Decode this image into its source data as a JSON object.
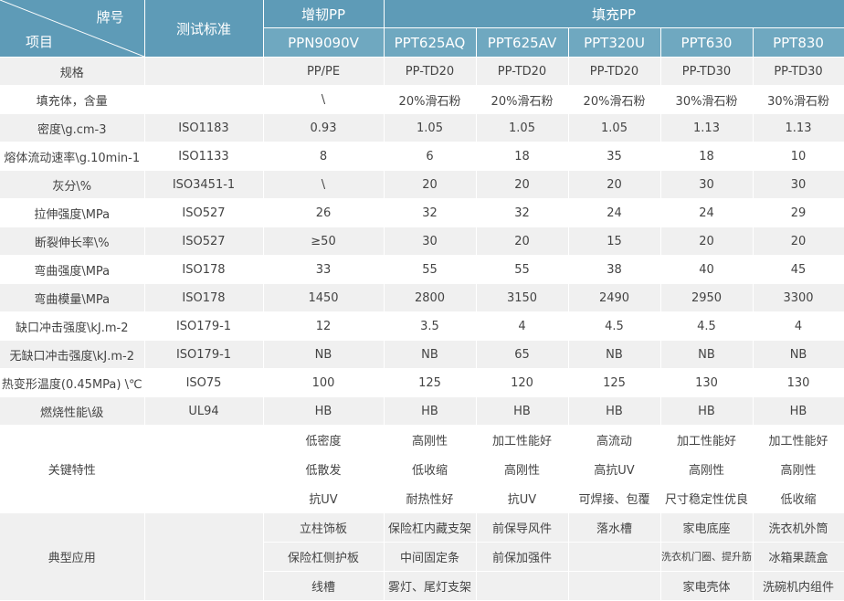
{
  "header": {
    "brand_label": "牌号",
    "item_label": "项目",
    "standard_label": "测试标准",
    "group_toughened": "增韧PP",
    "group_filled": "填充PP",
    "grades": [
      "PPN9090V",
      "PPT625AQ",
      "PPT625AV",
      "PPT320U",
      "PPT630",
      "PPT830"
    ]
  },
  "rows": [
    {
      "label": "规格",
      "standard": "",
      "values": [
        "PP/PE",
        "PP-TD20",
        "PP-TD20",
        "PP-TD20",
        "PP-TD30",
        "PP-TD30"
      ]
    },
    {
      "label": "填充体，含量",
      "standard": "",
      "values": [
        "\\",
        "20%滑石粉",
        "20%滑石粉",
        "20%滑石粉",
        "30%滑石粉",
        "30%滑石粉"
      ]
    },
    {
      "label": "密度\\g.cm-3",
      "standard": "ISO1183",
      "values": [
        "0.93",
        "1.05",
        "1.05",
        "1.05",
        "1.13",
        "1.13"
      ]
    },
    {
      "label": "熔体流动速率\\g.10min-1",
      "standard": "ISO1133",
      "values": [
        "8",
        "6",
        "18",
        "35",
        "18",
        "10"
      ]
    },
    {
      "label": "灰分\\%",
      "standard": "ISO3451-1",
      "values": [
        "\\",
        "20",
        "20",
        "20",
        "30",
        "30"
      ]
    },
    {
      "label": "拉伸强度\\MPa",
      "standard": "ISO527",
      "values": [
        "26",
        "32",
        "32",
        "24",
        "24",
        "29"
      ]
    },
    {
      "label": "断裂伸长率\\%",
      "standard": "ISO527",
      "values": [
        "≥50",
        "30",
        "20",
        "15",
        "20",
        "20"
      ]
    },
    {
      "label": "弯曲强度\\MPa",
      "standard": "ISO178",
      "values": [
        "33",
        "55",
        "55",
        "38",
        "40",
        "45"
      ]
    },
    {
      "label": "弯曲模量\\MPa",
      "standard": "ISO178",
      "values": [
        "1450",
        "2800",
        "3150",
        "2490",
        "2950",
        "3300"
      ]
    },
    {
      "label": "缺口冲击强度\\kJ.m-2",
      "standard": "ISO179-1",
      "values": [
        "12",
        "3.5",
        "4",
        "4.5",
        "4.5",
        "4"
      ]
    },
    {
      "label": "无缺口冲击强度\\kJ.m-2",
      "standard": "ISO179-1",
      "values": [
        "NB",
        "NB",
        "65",
        "NB",
        "NB",
        "NB"
      ]
    },
    {
      "label": "热变形温度(0.45MPa) \\℃",
      "standard": "ISO75",
      "values": [
        "100",
        "125",
        "120",
        "125",
        "130",
        "130"
      ]
    },
    {
      "label": "燃烧性能\\级",
      "standard": "UL94",
      "values": [
        "HB",
        "HB",
        "HB",
        "HB",
        "HB",
        "HB"
      ]
    }
  ],
  "features": {
    "label": "关键特性",
    "lines": [
      [
        "低密度",
        "高刚性",
        "加工性能好",
        "高流动",
        "加工性能好",
        "加工性能好"
      ],
      [
        "低散发",
        "低收缩",
        "高刚性",
        "高抗UV",
        "高刚性",
        "高刚性"
      ],
      [
        "抗UV",
        "耐热性好",
        "抗UV",
        "可焊接、包覆",
        "尺寸稳定性优良",
        "低收缩"
      ]
    ]
  },
  "applications": {
    "label": "典型应用",
    "lines": [
      [
        "立柱饰板",
        "保险杠内藏支架",
        "前保导风件",
        "落水槽",
        "家电底座",
        "洗衣机外筒"
      ],
      [
        "保险杠侧护板",
        "中间固定条",
        "前保加强件",
        "",
        "洗衣机门圈、提升筋",
        "冰箱果蔬盒"
      ],
      [
        "线槽",
        "雾灯、尾灯支架",
        "",
        "",
        "家电壳体",
        "洗碗机内组件"
      ]
    ]
  }
}
